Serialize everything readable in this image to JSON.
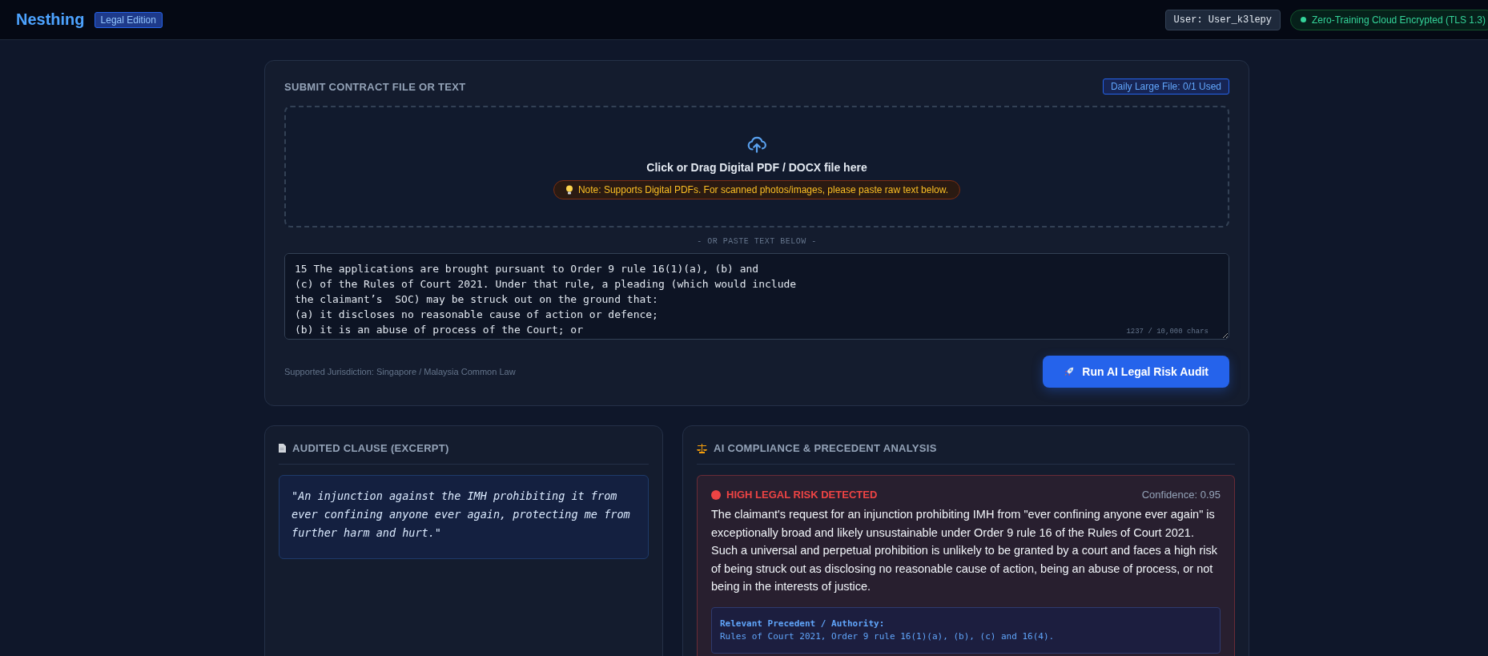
{
  "header": {
    "brand": "Nesthing",
    "edition": "Legal Edition",
    "user": "User: User_k3lepy",
    "security": {
      "label": "Zero-Training Cloud Encrypted (TLS 1.3)",
      "on": true
    }
  },
  "submit": {
    "title": "SUBMIT CONTRACT FILE OR TEXT",
    "quota": "Daily Large File: 0/1 Used",
    "dropzone": {
      "label": "Click or Drag Digital PDF / DOCX file here",
      "note": "Note: Supports Digital PDFs. For scanned photos/images, please paste raw text below."
    },
    "divider": "- OR PASTE TEXT BELOW -",
    "text": "15 The applications are brought pursuant to Order 9 rule 16(1)(a), (b) and\n(c) of the Rules of Court 2021. Under that rule, a pleading (which would include\nthe claimant’s  SOC) may be struck out on the ground that:\n(a) it discloses no reasonable cause of action or defence;\n(b) it is an abuse of process of the Court; or",
    "char_count": "1237 / 10,000 chars",
    "jurisdiction": "Supported Jurisdiction: Singapore / Malaysia Common Law",
    "run_button": "Run AI Legal Risk Audit"
  },
  "clause": {
    "title": "AUDITED CLAUSE (EXCERPT)",
    "quote": "\"An injunction against the IMH prohibiting it from ever confining anyone ever again, protecting me from further harm and hurt.\""
  },
  "analysis": {
    "title": "AI COMPLIANCE & PRECEDENT ANALYSIS",
    "result": {
      "color": "#ef4444",
      "label": "HIGH LEGAL RISK DETECTED",
      "confidence": "Confidence: 0.95",
      "summary": "The claimant's request for an injunction prohibiting IMH from \"ever confining anyone ever again\" is exceptionally broad and likely unsustainable under Order 9 rule 16 of the Rules of Court 2021. Such a universal and perpetual prohibition is unlikely to be granted by a court and faces a high risk of being struck out as disclosing no reasonable cause of action, being an abuse of process, or not being in the interests of justice.",
      "precedent_title": "Relevant Precedent / Authority:",
      "precedent": "Rules of Court 2021, Order 9 rule 16(1)(a), (b), (c) and 16(4)."
    }
  }
}
